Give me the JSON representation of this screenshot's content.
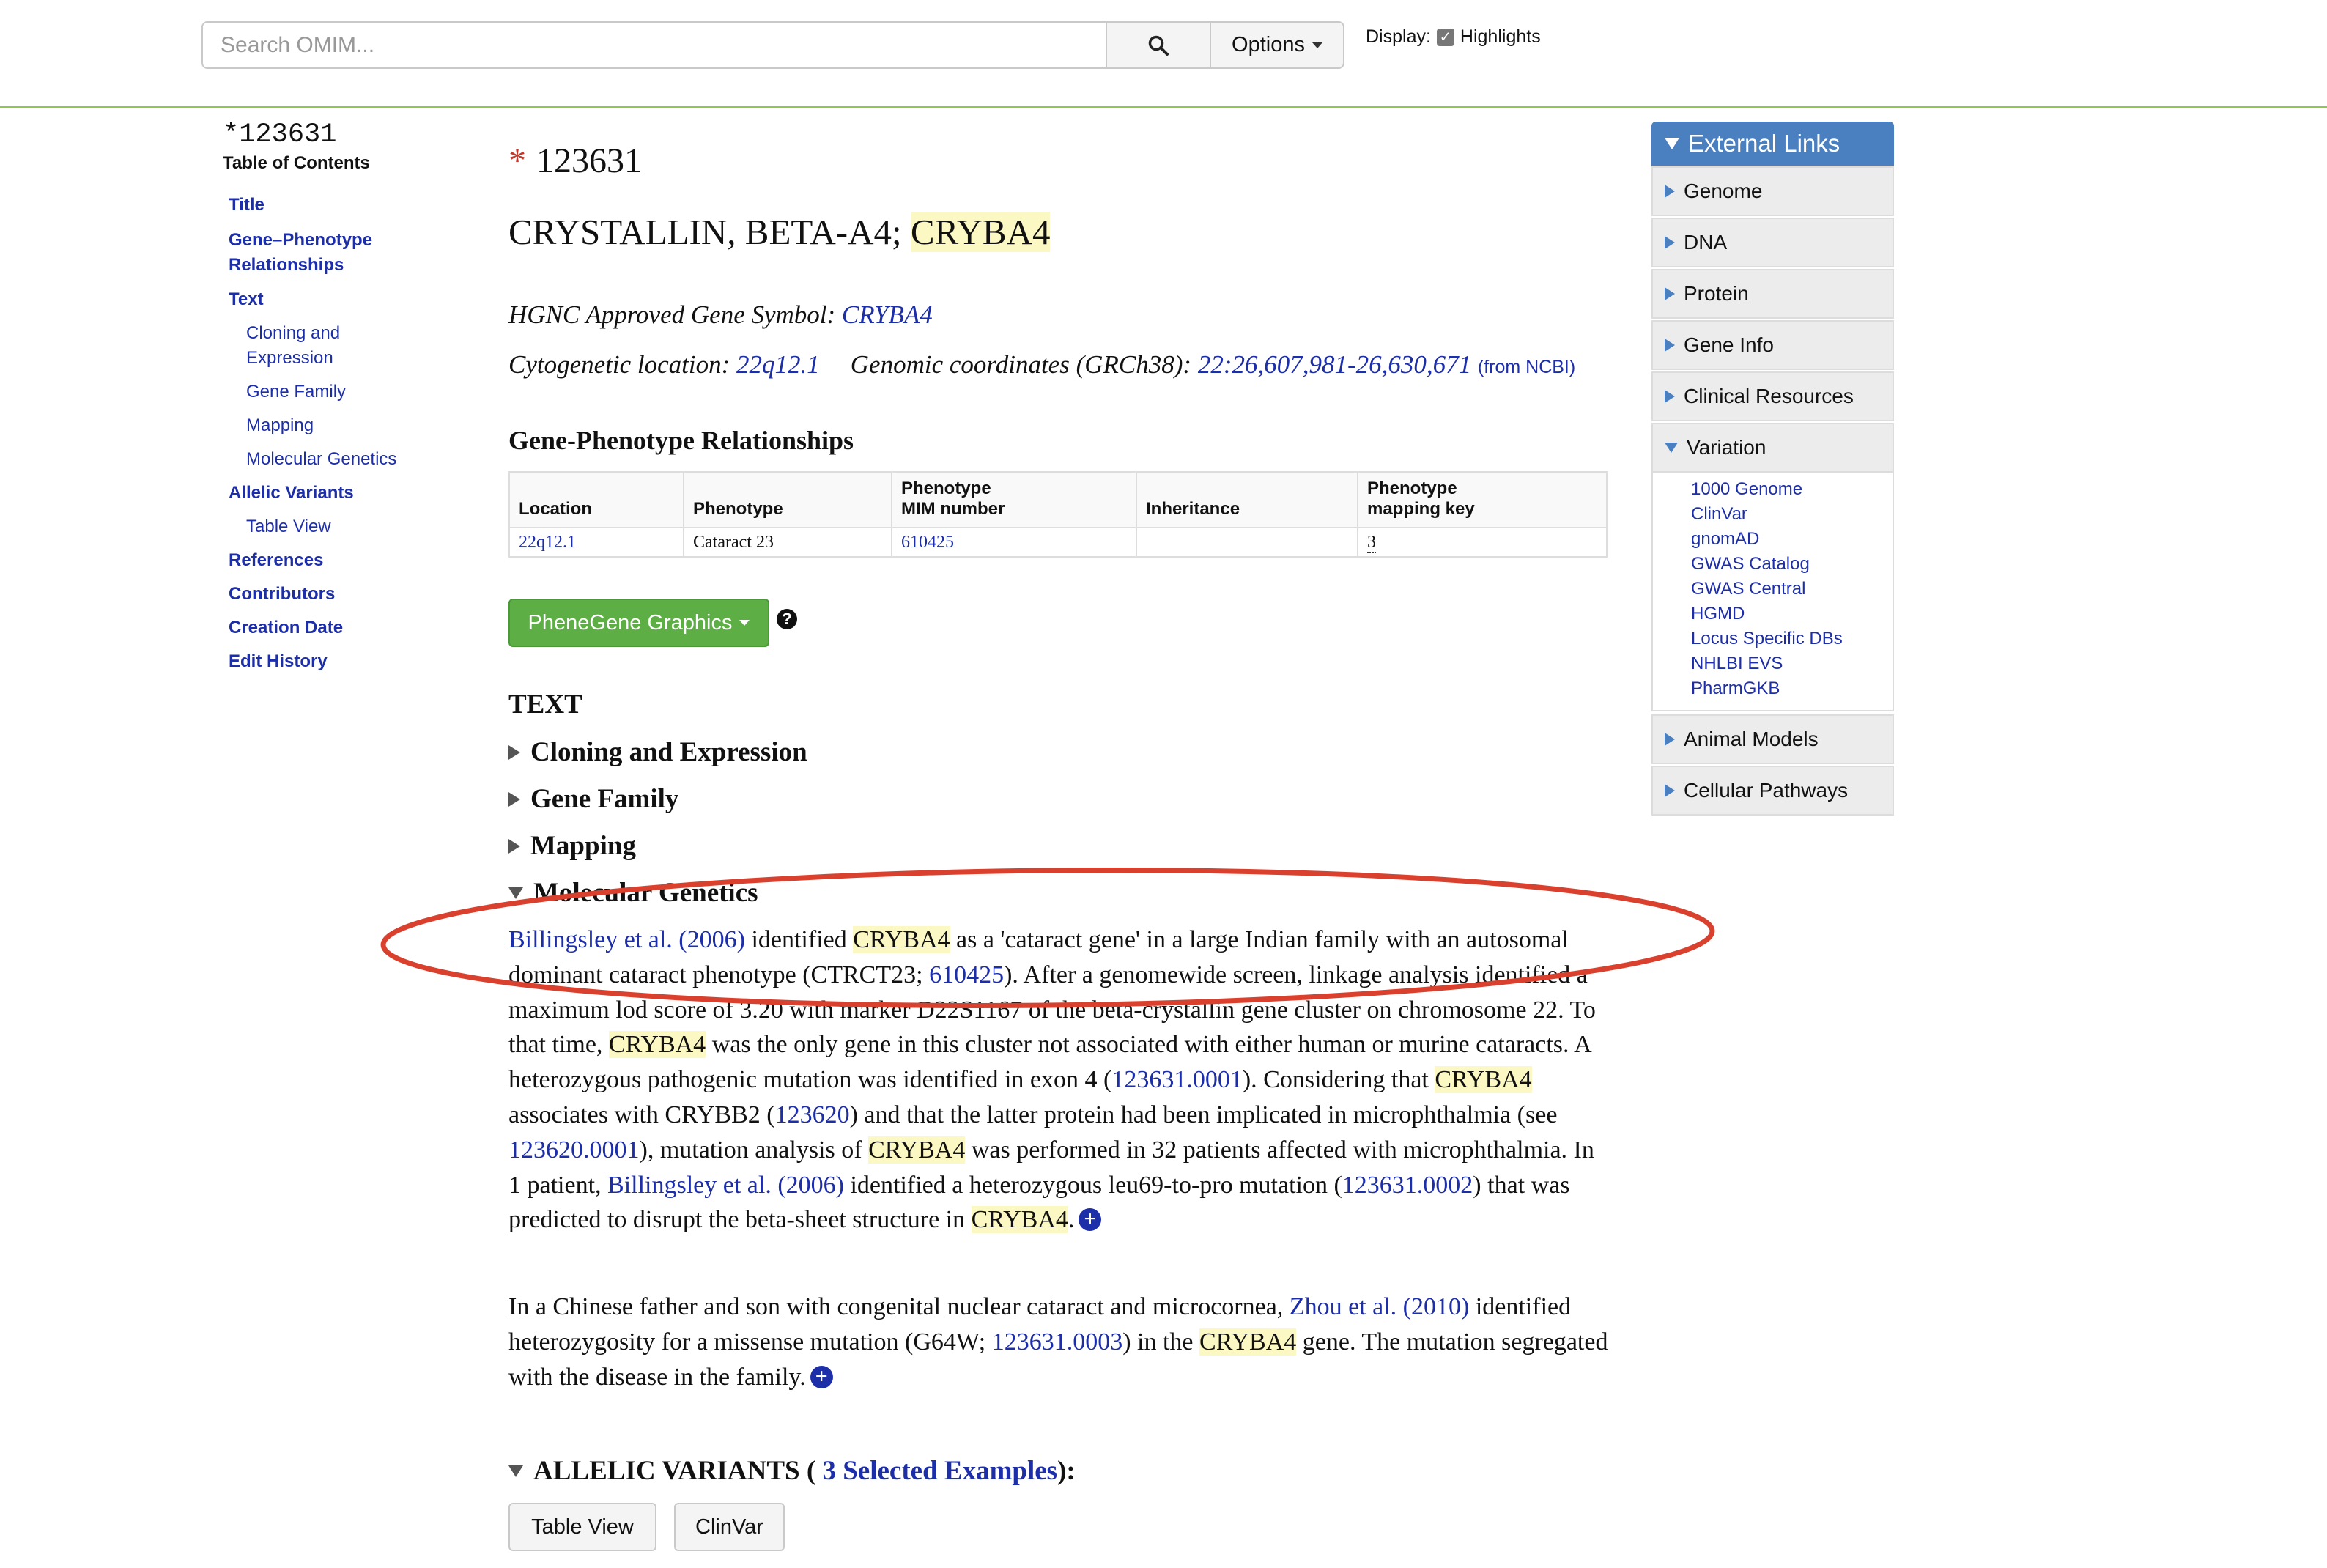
{
  "search": {
    "placeholder": "Search OMIM...",
    "options_label": "Options"
  },
  "display": {
    "label": "Display:",
    "highlights_label": "Highlights",
    "highlights_checked": true
  },
  "toc": {
    "mim": "*123631",
    "heading": "Table of Contents",
    "items": [
      {
        "label": "Title",
        "level": 0
      },
      {
        "label": "Gene–Phenotype",
        "level": 0
      },
      {
        "label": "Relationships",
        "level": 0
      },
      {
        "label": "Text",
        "level": 0
      },
      {
        "label": "Cloning and",
        "level": 1
      },
      {
        "label": "Expression",
        "level": 1
      },
      {
        "label": "Gene Family",
        "level": 1
      },
      {
        "label": "Mapping",
        "level": 1
      },
      {
        "label": "Molecular Genetics",
        "level": 1
      },
      {
        "label": "Allelic Variants",
        "level": 0
      },
      {
        "label": "Table View",
        "level": 1
      },
      {
        "label": "References",
        "level": 0
      },
      {
        "label": "Contributors",
        "level": 0
      },
      {
        "label": "Creation Date",
        "level": 0
      },
      {
        "label": "Edit History",
        "level": 0
      }
    ]
  },
  "entry": {
    "asterisk": "*",
    "number": "123631",
    "title_text": "CRYSTALLIN, BETA-A4; ",
    "title_symbol": "CRYBA4",
    "hgnc_label": "HGNC Approved Gene Symbol: ",
    "hgnc_symbol": "CRYBA4",
    "cyto_label": "Cytogenetic location: ",
    "cyto_value": "22q12.1",
    "coords_label": "Genomic coordinates (GRCh38): ",
    "coords_value": "22:26,607,981-26,630,671",
    "coords_source": "(from NCBI)"
  },
  "gpr": {
    "heading": "Gene-Phenotype Relationships",
    "headers": [
      "Location",
      "Phenotype",
      "Phenotype",
      "MIM number",
      "Inheritance",
      "Phenotype",
      "mapping key"
    ],
    "row": {
      "location": "22q12.1",
      "phenotype": "Cataract 23",
      "mim": "610425",
      "inheritance": "",
      "key": "3"
    }
  },
  "phenegene_label": "PheneGene Graphics",
  "help_icon": "?",
  "text": {
    "heading": "TEXT",
    "sections": [
      "Cloning and Expression",
      "Gene Family",
      "Mapping",
      "Molecular Genetics"
    ]
  },
  "mg_para1": [
    [
      "link",
      "Billingsley et al. (2006)"
    ],
    [
      "t",
      " identified "
    ],
    [
      "hl",
      "CRYBA4"
    ],
    [
      "t",
      " as a 'cataract gene' in a large Indian family with an autosomal dominant cataract phenotype (CTRCT23; "
    ],
    [
      "link",
      "610425"
    ],
    [
      "t",
      "). After a genomewide screen, linkage analysis identified a maximum lod score of 3.20 with marker D22S1167 of the beta-crystallin gene cluster on chromosome 22. To that time, "
    ],
    [
      "hl",
      "CRYBA4"
    ],
    [
      "t",
      " was the only gene in this cluster not associated with either human or murine cataracts. A heterozygous pathogenic mutation was identified in exon 4 ("
    ],
    [
      "link",
      "123631.0001"
    ],
    [
      "t",
      "). Considering that "
    ],
    [
      "hl",
      "CRYBA4"
    ],
    [
      "t",
      " associates with CRYBB2 ("
    ],
    [
      "link",
      "123620"
    ],
    [
      "t",
      ") and that the latter protein had been implicated in microphthalmia (see "
    ],
    [
      "link",
      "123620.0001"
    ],
    [
      "t",
      "), mutation analysis of "
    ],
    [
      "hl",
      "CRYBA4"
    ],
    [
      "t",
      " was performed in 32 patients affected with microphthalmia. In 1 patient, "
    ],
    [
      "link",
      "Billingsley et al. (2006)"
    ],
    [
      "t",
      " identified a heterozygous leu69-to-pro mutation ("
    ],
    [
      "link",
      "123631.0002"
    ],
    [
      "t",
      ") that was predicted to disrupt the beta-sheet structure in "
    ],
    [
      "hl",
      "CRYBA4"
    ],
    [
      "t",
      "."
    ]
  ],
  "mg_para2": [
    [
      "t",
      "In a Chinese father and son with congenital nuclear cataract and microcornea, "
    ],
    [
      "link",
      "Zhou et al. (2010)"
    ],
    [
      "t",
      " identified heterozygosity for a missense mutation (G64W; "
    ],
    [
      "link",
      "123631.0003"
    ],
    [
      "t",
      ") in the "
    ],
    [
      "hl",
      "CRYBA4"
    ],
    [
      "t",
      " gene. The mutation segregated with the disease in the family."
    ]
  ],
  "plus_icon": "+",
  "allelic": {
    "prefix": "ALLELIC VARIANTS (",
    "link": " 3 Selected Examples",
    "suffix": "):",
    "table_view": "Table View",
    "clinvar": "ClinVar"
  },
  "external_links": {
    "title": "External Links",
    "items_top": [
      "Genome",
      "DNA",
      "Protein",
      "Gene Info",
      "Clinical Resources"
    ],
    "variation": {
      "label": "Variation",
      "items": [
        "1000 Genome",
        "ClinVar",
        "gnomAD",
        "GWAS Catalog",
        "GWAS Central",
        "HGMD",
        "Locus Specific DBs",
        "NHLBI EVS",
        "PharmGKB"
      ]
    },
    "items_bottom": [
      "Animal Models",
      "Cellular Pathways"
    ]
  },
  "colors": {
    "accent_green": "#8cc84b",
    "link_blue": "#1d2ea9",
    "highlight": "#fcf8c4",
    "annotation_red": "#d9412e",
    "panel_blue": "#4a7fc0"
  }
}
